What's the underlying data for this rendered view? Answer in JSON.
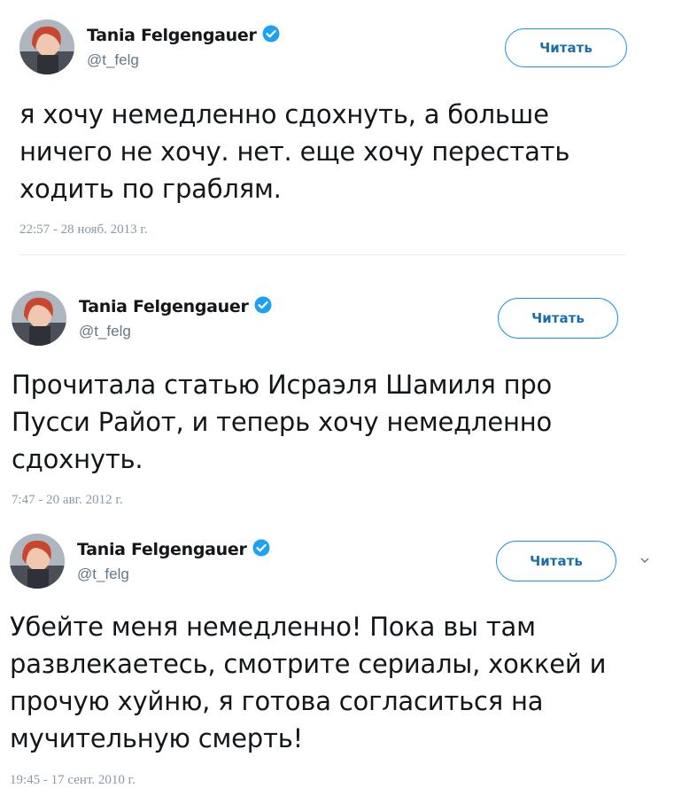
{
  "tweets": [
    {
      "name": "Tania Felgengauer",
      "handle": "@t_felg",
      "follow_label": "Читать",
      "text_lines": [
        "я хочу немедленно сдохнуть, а больше",
        "ничего не хочу. нет. еще хочу перестать",
        "ходить по граблям."
      ],
      "timestamp": "22:57 - 28 нояб. 2013 г."
    },
    {
      "name": "Tania Felgengauer",
      "handle": "@t_felg",
      "follow_label": "Читать",
      "text_lines": [
        "Прочитала статью Исраэля Шамиля про",
        "Пусси Райот, и теперь хочу немедленно",
        "сдохнуть."
      ],
      "timestamp": "7:47 - 20 авг. 2012 г."
    },
    {
      "name": "Tania Felgengauer",
      "handle": "@t_felg",
      "follow_label": "Читать",
      "text_lines": [
        "Убейте меня немедленно! Пока вы там",
        "развлекаетесь, смотрите сериалы, хоккей и",
        "прочую хуйню, я готова согласиться на",
        "мучительную смерть!"
      ],
      "timestamp": "19:45 - 17 сент. 2010 г."
    }
  ],
  "icons": {
    "verified": "verified-badge-icon",
    "more": "chevron-down-icon"
  },
  "colors": {
    "accent": "#1b95e0",
    "secondary_text": "#657786",
    "timestamp": "#8899a6"
  }
}
